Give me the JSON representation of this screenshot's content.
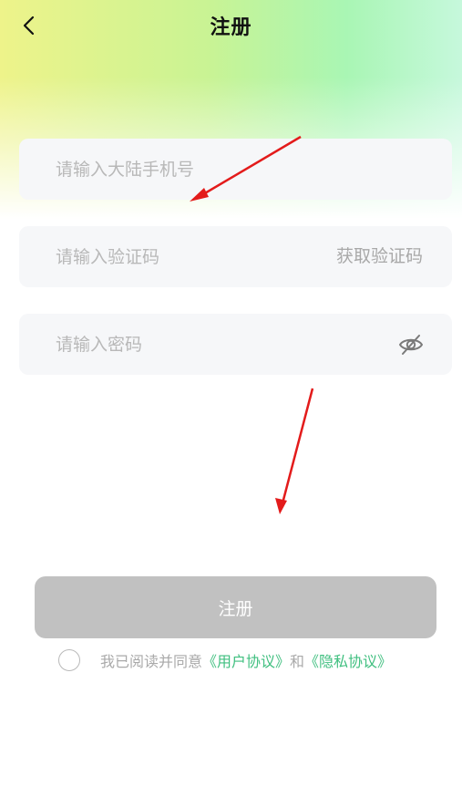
{
  "header": {
    "title": "注册"
  },
  "form": {
    "phone_placeholder": "请输入大陆手机号",
    "code_placeholder": "请输入验证码",
    "get_code_label": "获取验证码",
    "password_placeholder": "请输入密码"
  },
  "register_button": {
    "label": "注册"
  },
  "agreement": {
    "prefix": "我已阅读并同意",
    "user_agreement": "《用户协议》",
    "conjunction": "和",
    "privacy_agreement": "《隐私协议》"
  },
  "colors": {
    "link": "#3fbf7f",
    "button_disabled": "#c1c1c1",
    "annotation_arrow": "#e31b1b"
  },
  "icons": {
    "back": "chevron-left-icon",
    "password_visibility": "eye-slash-icon"
  }
}
